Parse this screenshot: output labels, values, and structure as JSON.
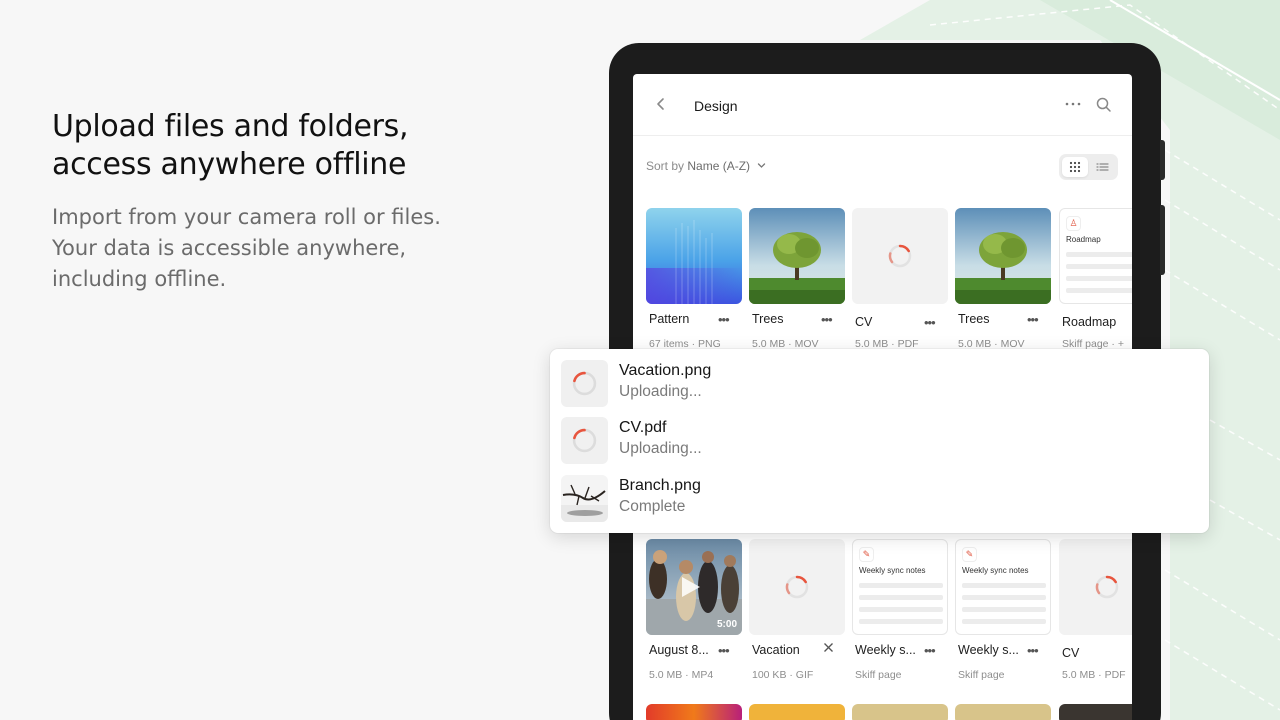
{
  "marketing": {
    "headline": "Upload files and folders, access anywhere offline",
    "description": "Import from your camera roll or files. Your data is accessible anywhere, including offline."
  },
  "app": {
    "folder_title": "Design",
    "sort_label": "Sort by",
    "sort_value": "Name (A-Z)",
    "view_mode": "grid"
  },
  "files_row1": [
    {
      "name": "Pattern",
      "meta": "67 items · PNG",
      "thumb": "pattern"
    },
    {
      "name": "Trees",
      "meta": "5.0 MB · MOV",
      "thumb": "tree"
    },
    {
      "name": "CV",
      "meta": "5.0 MB · PDF",
      "thumb": "loading"
    },
    {
      "name": "Trees",
      "meta": "5.0 MB · MOV",
      "thumb": "tree"
    },
    {
      "name": "Roadmap",
      "meta": "Skiff page · +",
      "thumb": "page",
      "page_title": "Roadmap"
    }
  ],
  "files_row2": [
    {
      "name": "August 8...",
      "meta": "5.0 MB · MP4",
      "thumb": "video",
      "duration": "5:00"
    },
    {
      "name": "Vacation",
      "meta": "100 KB · GIF",
      "thumb": "loading"
    },
    {
      "name": "Weekly s...",
      "meta": "Skiff page",
      "thumb": "page",
      "page_title": "Weekly sync notes"
    },
    {
      "name": "Weekly s...",
      "meta": "Skiff page",
      "thumb": "page",
      "page_title": "Weekly sync notes"
    },
    {
      "name": "CV",
      "meta": "5.0 MB · PDF",
      "thumb": "loading"
    }
  ],
  "uploads": [
    {
      "name": "Vacation.png",
      "status": "Uploading...",
      "state": "uploading"
    },
    {
      "name": "CV.pdf",
      "status": "Uploading...",
      "state": "uploading"
    },
    {
      "name": "Branch.png",
      "status": "Complete",
      "state": "complete"
    }
  ],
  "colors": {
    "accent_spinner": "#e8553e",
    "background_green": "#e3f0e5"
  }
}
